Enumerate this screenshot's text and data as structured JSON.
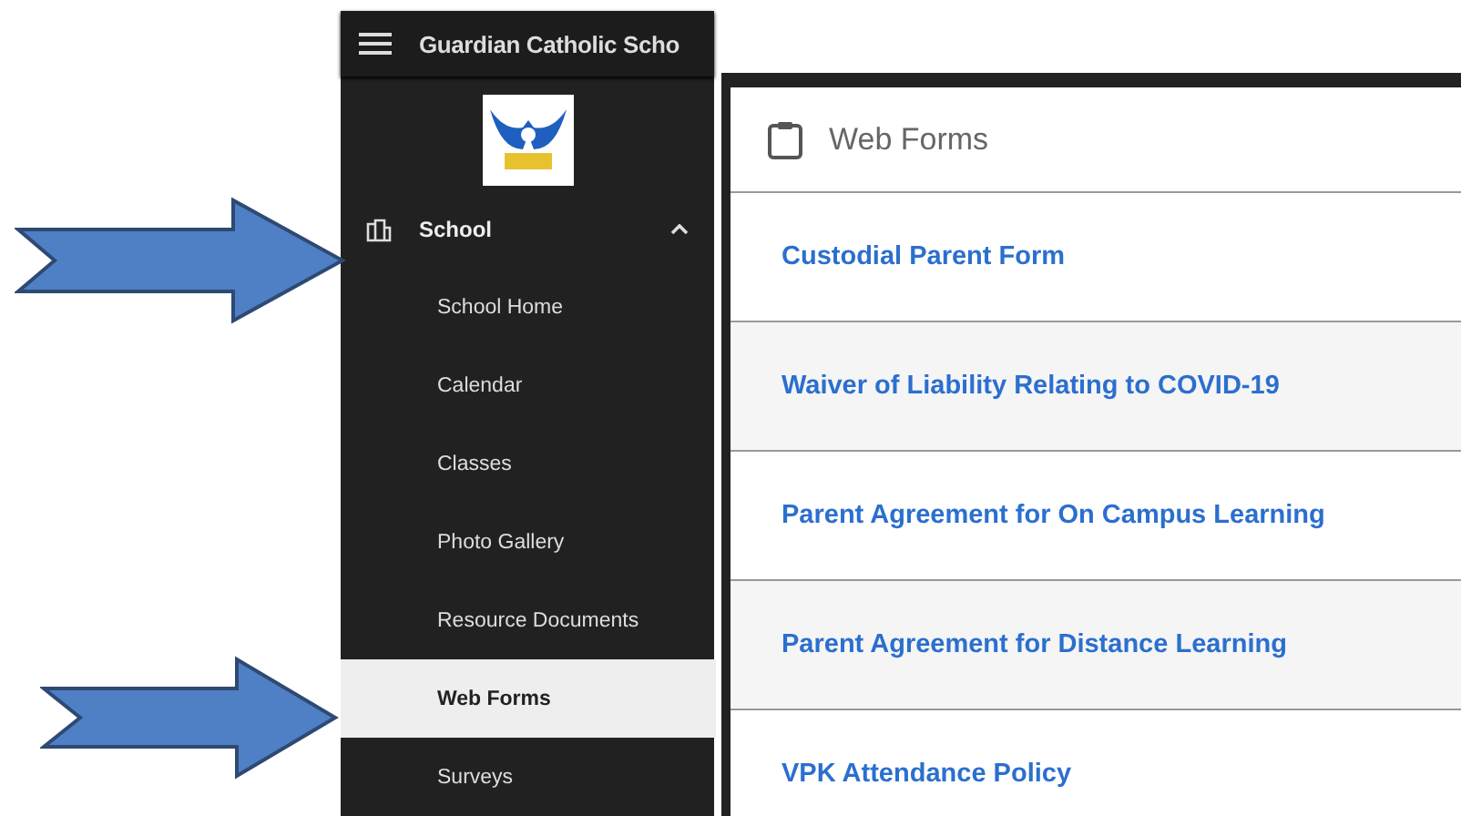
{
  "sidebar": {
    "title": "Guardian Catholic Scho",
    "section": {
      "label": "School",
      "expanded": true
    },
    "items": [
      {
        "label": "School Home",
        "selected": false
      },
      {
        "label": "Calendar",
        "selected": false
      },
      {
        "label": "Classes",
        "selected": false
      },
      {
        "label": "Photo Gallery",
        "selected": false
      },
      {
        "label": "Resource Documents",
        "selected": false
      },
      {
        "label": "Web Forms",
        "selected": true
      },
      {
        "label": "Surveys",
        "selected": false
      }
    ]
  },
  "panel": {
    "title": "Web Forms",
    "forms": [
      {
        "label": "Custodial Parent Form"
      },
      {
        "label": "Waiver of Liability Relating to COVID-19"
      },
      {
        "label": "Parent Agreement for On Campus Learning"
      },
      {
        "label": "Parent Agreement for Distance Learning"
      },
      {
        "label": "VPK Attendance Policy"
      }
    ]
  }
}
